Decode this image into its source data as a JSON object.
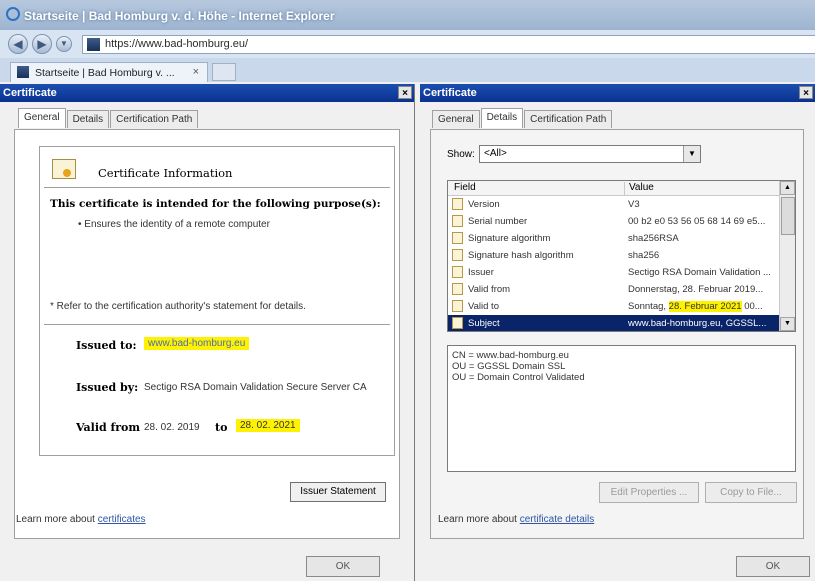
{
  "browser": {
    "title": "Startseite | Bad Homburg v. d. Höhe - Internet Explorer",
    "url": "https://www.bad-homburg.eu/",
    "tab_label": "Startseite | Bad Homburg v. ...",
    "tab_close": "×"
  },
  "left_dialog": {
    "title": "Certificate",
    "close": "×",
    "tabs": [
      "General",
      "Details",
      "Certification Path"
    ],
    "info_title": "Certificate Information",
    "purpose_heading": "This certificate is intended for the following purpose(s):",
    "purposes": [
      "• Ensures the identity of a remote computer"
    ],
    "refer_note": "* Refer to the certification authority's statement for details.",
    "issued_to_label": "Issued to:",
    "issued_to_value": "www.bad-homburg.eu",
    "issued_by_label": "Issued by:",
    "issued_by_value": "Sectigo RSA Domain Validation Secure Server CA",
    "valid_from_label": "Valid from",
    "valid_from_value": "28. 02. 2019",
    "valid_to_label": "to",
    "valid_to_value": "28. 02. 2021",
    "issuer_button": "Issuer Statement",
    "learn_text": "Learn more about",
    "learn_link": "certificates",
    "ok": "OK"
  },
  "right_dialog": {
    "title": "Certificate",
    "close": "×",
    "tabs": [
      "General",
      "Details",
      "Certification Path"
    ],
    "show_label": "Show:",
    "show_value": "<All>",
    "columns": {
      "field": "Field",
      "value": "Value"
    },
    "rows": [
      {
        "field": "Version",
        "value": "V3"
      },
      {
        "field": "Serial number",
        "value": "00 b2 e0 53 56 05 68 14 69 e5..."
      },
      {
        "field": "Signature algorithm",
        "value": "sha256RSA"
      },
      {
        "field": "Signature hash algorithm",
        "value": "sha256"
      },
      {
        "field": "Issuer",
        "value": "Sectigo RSA Domain Validation ..."
      },
      {
        "field": "Valid from",
        "value": "Donnerstag, 28. Februar 2019..."
      },
      {
        "field": "Valid to",
        "value_pre": "Sonntag, ",
        "value_hl": "28. Februar 2021",
        "value_post": " 00..."
      },
      {
        "field": "Subject",
        "value": "www.bad-homburg.eu, GGSSL..."
      }
    ],
    "selected_row": "Subject",
    "detail_lines": [
      "CN = www.bad-homburg.eu",
      "OU = GGSSL Domain SSL",
      "OU = Domain Control Validated"
    ],
    "edit_button": "Edit Properties ...",
    "copy_button": "Copy to File...",
    "learn_text": "Learn more about",
    "learn_link": "certificate details",
    "ok": "OK"
  },
  "colors": {
    "titlebar": "#0a3191",
    "highlight": "#fff200",
    "selection": "#0a246a"
  }
}
